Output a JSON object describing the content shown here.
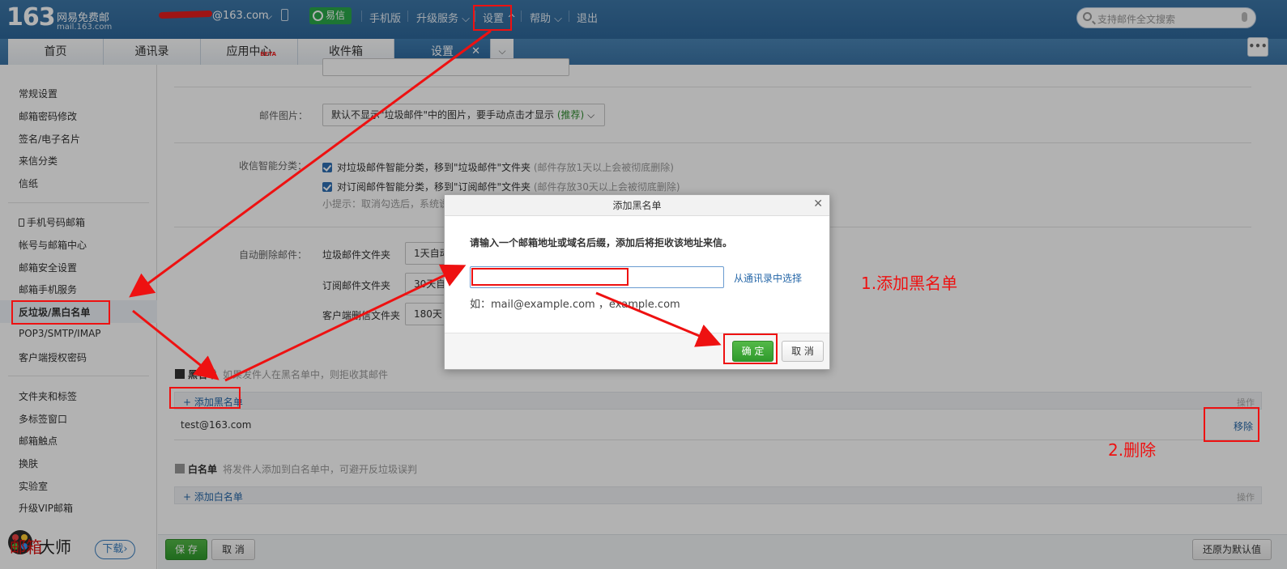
{
  "header": {
    "logo_number": "163",
    "logo_title": "网易免费邮",
    "logo_url": "mail.163.com",
    "user_domain": "@163.com",
    "yixin_label": "易信",
    "nav": [
      "手机版",
      "升级服务",
      "设置",
      "帮助",
      "退出"
    ],
    "search_placeholder": "支持邮件全文搜索"
  },
  "tabs": [
    {
      "label": "首页"
    },
    {
      "label": "通讯录"
    },
    {
      "label": "应用中心",
      "badge": "BETA"
    },
    {
      "label": "收件箱"
    },
    {
      "label": "设置",
      "active": true
    }
  ],
  "sidebar": {
    "group1": [
      "常规设置",
      "邮箱密码修改",
      "签名/电子名片",
      "来信分类",
      "信纸"
    ],
    "group2": [
      "手机号码邮箱",
      "帐号与邮箱中心",
      "邮箱安全设置",
      "邮箱手机服务",
      "反垃圾/黑白名单",
      "POP3/SMTP/IMAP",
      "客户端授权密码"
    ],
    "group3": [
      "文件夹和标签",
      "多标签窗口",
      "邮箱触点",
      "换肤",
      "实验室",
      "升级VIP邮箱"
    ],
    "brand_mail": "邮箱",
    "brand_master": "大师",
    "download": "下载"
  },
  "main": {
    "mail_images_label": "邮件图片：",
    "mail_images_value": "默认不显示\"垃圾邮件\"中的图片，要手动点击才显示",
    "mail_images_tag": "(推荐)",
    "smart_label": "收信智能分类：",
    "smart_opt1": "对垃圾邮件智能分类，移到\"垃圾邮件\"文件夹",
    "smart_opt1_note": "(邮件存放1天以上会被彻底删除)",
    "smart_opt2": "对订阅邮件智能分类，移到\"订阅邮件\"文件夹",
    "smart_opt2_note": "(邮件存放30天以上会被彻底删除)",
    "smart_tip": "小提示：取消勾选后，系统说",
    "auto_delete_label": "自动删除邮件：",
    "auto_rows": [
      {
        "label": "垃圾邮件文件夹",
        "value": "1天自动"
      },
      {
        "label": "订阅邮件文件夹",
        "value": "30天自"
      },
      {
        "label": "客户端删信文件夹",
        "value": "180天"
      }
    ],
    "blacklist_title": "黑名单",
    "blacklist_desc": "如果发件人在黑名单中，则拒收其邮件",
    "add_blacklist": "+ 添加黑名单",
    "ops_label": "操作",
    "blacklist_entry": "test@163.com",
    "remove_label": "移除",
    "whitelist_title": "白名单",
    "whitelist_desc": "将发件人添加到白名单中，可避开反垃圾误判",
    "add_whitelist": "+ 添加白名单",
    "save": "保 存",
    "cancel": "取 消",
    "restore_default": "还原为默认值"
  },
  "dialog": {
    "title": "添加黑名单",
    "message": "请输入一个邮箱地址或域名后缀，添加后将拒收该地址来信。",
    "input_value": "",
    "pick_from_contacts": "从通讯录中选择",
    "example": "如：mail@example.com ，example.com",
    "ok": "确 定",
    "cancel": "取 消"
  },
  "annotations": {
    "step1": "1.添加黑名单",
    "step2": "2.删除",
    "color": "#ee1111"
  }
}
